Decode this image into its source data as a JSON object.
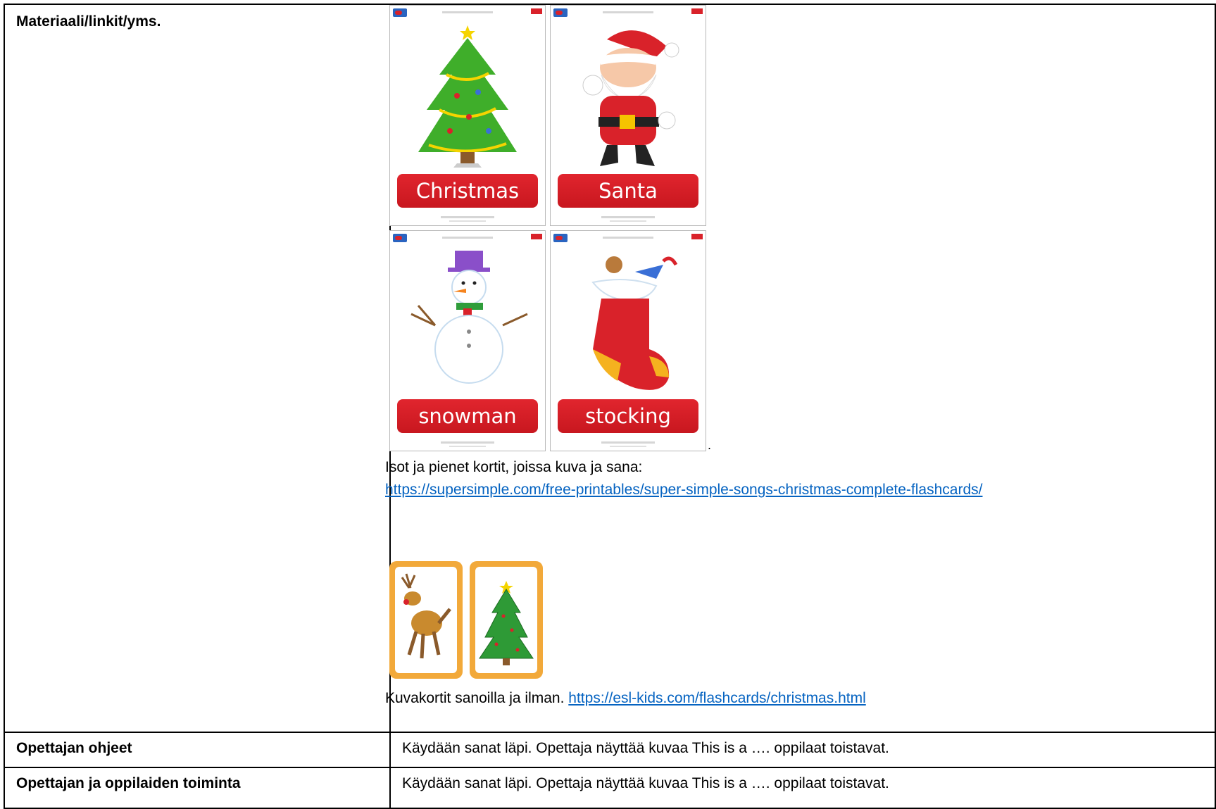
{
  "rows": {
    "materials": {
      "label": "Materiaali/linkit/yms.",
      "flashcards": [
        {
          "word": "Christmas tree",
          "icon": "christmas-tree-icon"
        },
        {
          "word": "Santa",
          "icon": "santa-icon"
        },
        {
          "word": "snowman",
          "icon": "snowman-icon"
        },
        {
          "word": "stocking",
          "icon": "stocking-icon"
        }
      ],
      "trailing_dot": ".",
      "description_1": "Isot ja pienet kortit, joissa kuva ja sana:",
      "link_1": "https://supersimple.com/free-printables/super-simple-songs-christmas-complete-flashcards/",
      "picture_cards": [
        {
          "icon": "reindeer-icon"
        },
        {
          "icon": "christmas-tree-icon"
        }
      ],
      "description_2": "Kuvakortit sanoilla ja ilman. ",
      "link_2": "https://esl-kids.com/flashcards/christmas.html"
    },
    "teacher_instructions": {
      "label": "Opettajan ohjeet",
      "text": "Käydään sanat läpi. Opettaja näyttää kuvaa This is a …. oppilaat toistavat."
    },
    "teacher_student_activity": {
      "label": "Opettajan ja oppilaiden toiminta",
      "text": "Käydään sanat läpi. Opettaja näyttää kuvaa This is a …. oppilaat toistavat."
    }
  },
  "colors": {
    "link": "#0563c1",
    "card_label_red": "#d9222a",
    "card_frame_orange": "#f2a93a",
    "border": "#000000"
  }
}
